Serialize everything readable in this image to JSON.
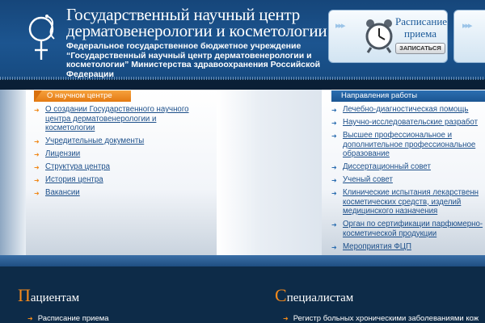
{
  "header": {
    "title_line1": "Государственный научный центр",
    "title_line2": "дерматовенерологии и косметологии",
    "subtitle": "Федеральное государственное бюджетное учреждение “Государственный научный центр дерматовенерологии и косметологии” Министерства здравоохранения Российской Федерации"
  },
  "schedule": {
    "title_line1": "Расписание",
    "title_line2": "приема",
    "button_label": "ЗАПИСАТЬСЯ"
  },
  "left": {
    "tab_label": "О научном центре",
    "items": [
      {
        "label": "О создании Государственного научного центра дерматовенерологии и косметологии"
      },
      {
        "label": "Учредительные документы"
      },
      {
        "label": "Лицензии"
      },
      {
        "label": "Структура центра"
      },
      {
        "label": "История центра"
      },
      {
        "label": "Вакансии"
      }
    ]
  },
  "right": {
    "tab_label": "Направления работы",
    "items": [
      {
        "label": "Лечебно-диагностическая помощь"
      },
      {
        "label": "Научно-исследовательские разработ"
      },
      {
        "label": "Высшее профессиональное и дополнительное профессиональное образование"
      },
      {
        "label": "Диссертационный совет"
      },
      {
        "label": "Ученый совет"
      },
      {
        "label": "Клинические испытания лекарственн косметических средств, изделий медицинского назначения"
      },
      {
        "label": "Орган по сертификации парфюмерно- косметической продукции"
      },
      {
        "label": "Мероприятия ФЦП"
      }
    ]
  },
  "lower": {
    "patients_initial": "П",
    "patients_rest": "ациентам",
    "patients_item": "Расписание приема",
    "specialists_initial": "С",
    "specialists_rest": "пециалистам",
    "specialists_item": "Регистр больных хроническими заболеваниями кож"
  },
  "icons": {
    "logo": "medical-logo-icon",
    "clock": "alarm-clock-icon",
    "arrows": "arrows-icon",
    "bullet": "arrow-bullet-icon"
  },
  "colors": {
    "header_blue": "#1c5590",
    "accent_orange": "#f08a1c",
    "link_blue": "#1c4f8a",
    "dark_navy": "#0d2b48"
  }
}
